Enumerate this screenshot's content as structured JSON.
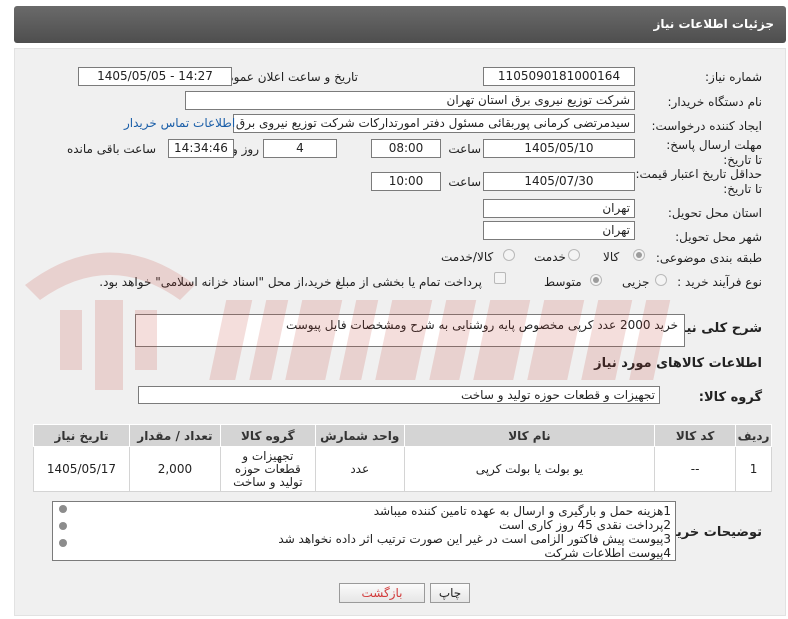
{
  "header": {
    "title": "جزئیات اطلاعات نیاز"
  },
  "form": {
    "need_number_label": "شماره نیاز:",
    "need_number": "1105090181000164",
    "announce_label": "تاریخ و ساعت اعلان عمومی:",
    "announce_value": "1405/05/05 - 14:27",
    "buyer_org_label": "نام دستگاه خریدار:",
    "buyer_org": "شرکت توزیع نیروی برق استان تهران",
    "requester_label": "ایجاد کننده درخواست:",
    "requester": "سیدمرتضی کرمانی پوربقائی مسئول دفتر امورتدارکات شرکت توزیع نیروی برق استان تهران",
    "contact_link": "اطلاعات تماس خریدار",
    "deadline_label": "مهلت ارسال پاسخ: تا تاریخ:",
    "deadline_date": "1405/05/10",
    "time_label": "ساعت",
    "deadline_time": "08:00",
    "days_value": "4",
    "days_label": "روز و",
    "remaining_time": "14:34:46",
    "remaining_label": "ساعت باقی مانده",
    "validity_label": "حداقل تاریخ اعتبار قیمت: تا تاریخ:",
    "validity_date": "1405/07/30",
    "validity_time": "10:00",
    "province_label": "استان محل تحویل:",
    "province": "تهران",
    "city_label": "شهر محل تحویل:",
    "city": "تهران",
    "category_label": "طبقه بندی موضوعی:",
    "category_options": [
      "کالا",
      "خدمت",
      "کالا/خدمت"
    ],
    "process_label": "نوع فرآیند خرید :",
    "process_options": [
      "جزیی",
      "متوسط"
    ],
    "payment_note": "پرداخت تمام یا بخشی از مبلغ خرید،از محل \"اسناد خزانه اسلامی\" خواهد بود."
  },
  "description": {
    "label": "شرح کلی نیاز:",
    "text": "خرید 2000 عدد کرپی مخصوص پایه روشنایی به  شرح ومشخصات فایل پیوست"
  },
  "goods": {
    "section_title": "اطلاعات کالاهای مورد نیاز",
    "group_label": "گروه کالا:",
    "group_value": "تجهیزات و قطعات حوزه تولید و ساخت",
    "columns": [
      "ردیف",
      "کد کالا",
      "نام کالا",
      "واحد شمارش",
      "گروه کالا",
      "تعداد / مقدار",
      "تاریخ نیاز"
    ],
    "rows": [
      {
        "row": "1",
        "code": "--",
        "name": "یو بولت یا بولت کرپی",
        "unit": "عدد",
        "group": "تجهیزات و قطعات حوزه تولید و ساخت",
        "qty": "2,000",
        "date": "1405/05/17"
      }
    ]
  },
  "buyer_notes": {
    "label": "توضیحات خریدار:",
    "lines": [
      "1هزینه حمل و بارگیری و ارسال به عهده تامین کننده میباشد",
      "2پرداخت نقدی 45 روز کاری است",
      "3پیوست پیش فاکتور الزامی است در غیر این صورت ترتیب اثر داده نخواهد شد",
      "4پیوست اطلاعات شرکت"
    ]
  },
  "buttons": {
    "print": "چاپ",
    "back": "بازگشت"
  },
  "colors": {
    "header_bg": "#5a5a5a",
    "panel_bg": "#f0f0f0",
    "link": "#1a5ea8",
    "back_text": "#d23b3b",
    "watermark": "#c0392b"
  }
}
